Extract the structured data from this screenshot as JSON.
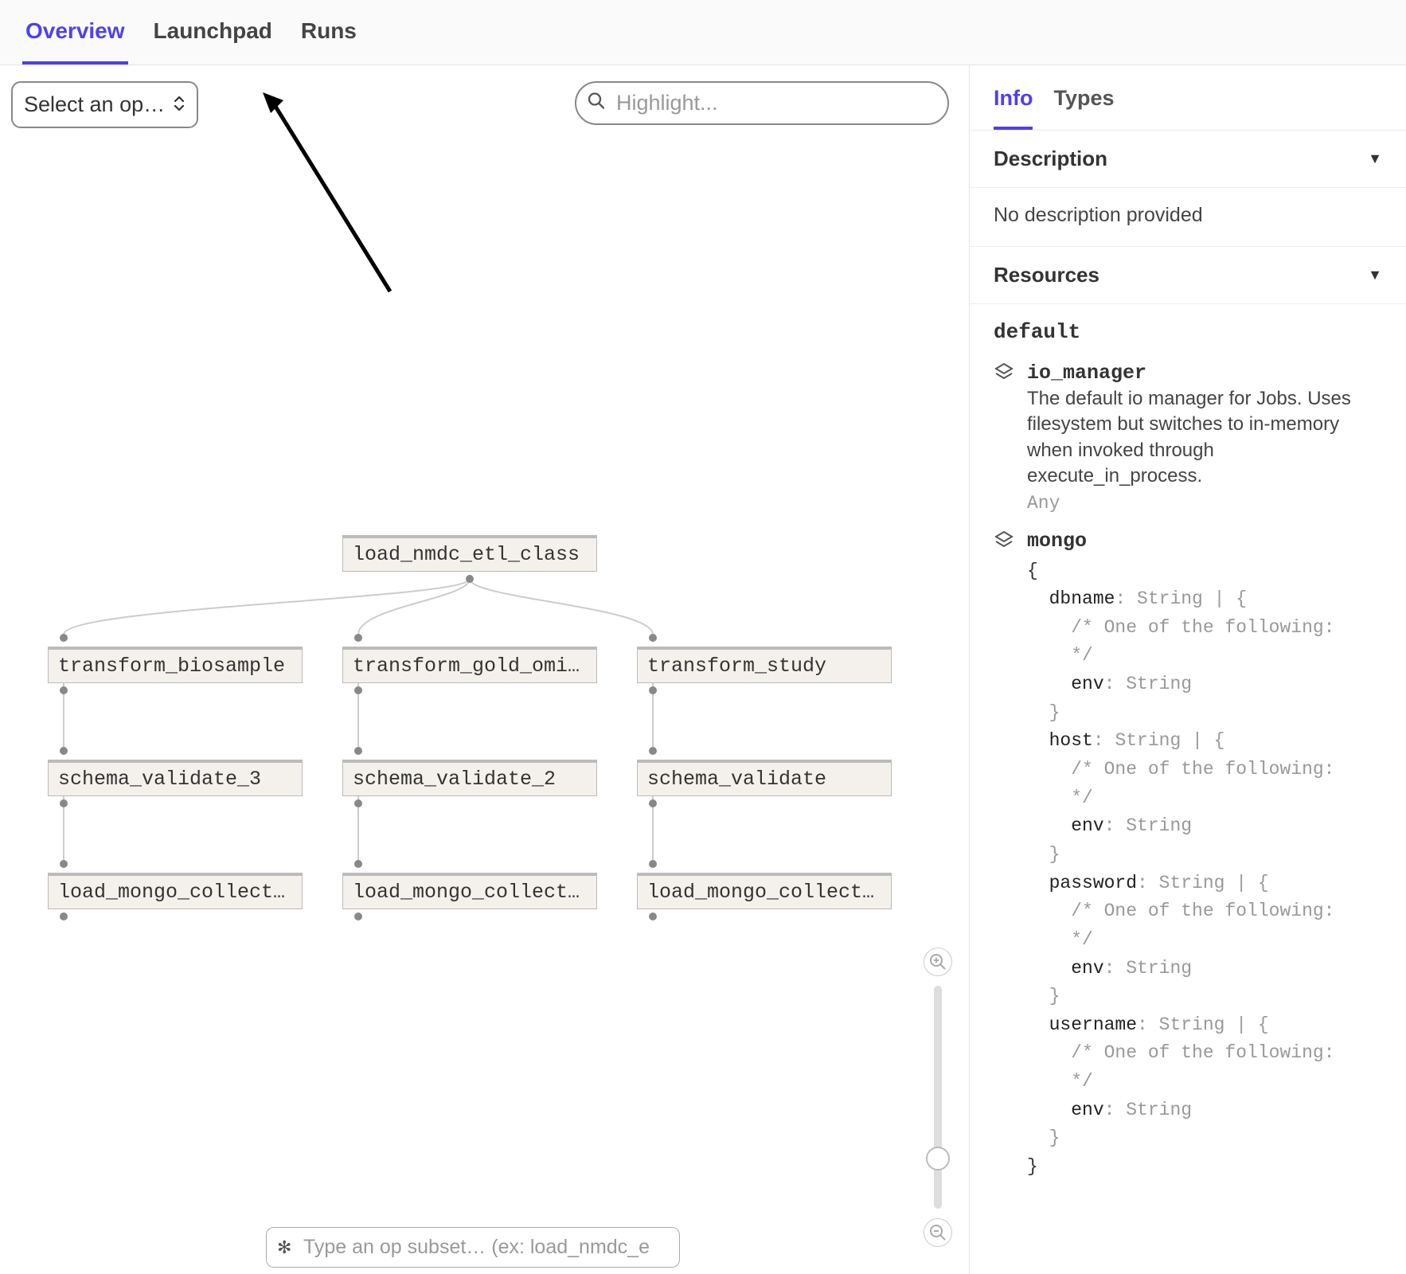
{
  "tabs": {
    "overview": "Overview",
    "launchpad": "Launchpad",
    "runs": "Runs"
  },
  "toolbar": {
    "select_label": "Select an op…",
    "highlight_placeholder": "Highlight...",
    "subset_placeholder": "Type an op subset… (ex: load_nmdc_e"
  },
  "nodes": {
    "root": "load_nmdc_etl_class",
    "a1": "transform_biosample",
    "a2": "transform_gold_omics…",
    "a3": "transform_study",
    "b1": "schema_validate_3",
    "b2": "schema_validate_2",
    "b3": "schema_validate",
    "c1": "load_mongo_collectio…",
    "c2": "load_mongo_collectio…",
    "c3": "load_mongo_collection"
  },
  "side": {
    "tabs": {
      "info": "Info",
      "types": "Types"
    },
    "description_header": "Description",
    "description_body": "No description provided",
    "resources_header": "Resources",
    "group_name": "default",
    "io_manager": {
      "name": "io_manager",
      "desc": "The default io manager for Jobs. Uses filesystem but switches to in-memory when invoked through execute_in_process.",
      "type": "Any"
    },
    "mongo": {
      "name": "mongo",
      "keys": {
        "dbname": "dbname",
        "host": "host",
        "password": "password",
        "username": "username"
      },
      "sig": "String | {",
      "comment": "/* One of the following:",
      "comment2": "*/",
      "env": "env",
      "envType": "String",
      "close": "}"
    }
  }
}
